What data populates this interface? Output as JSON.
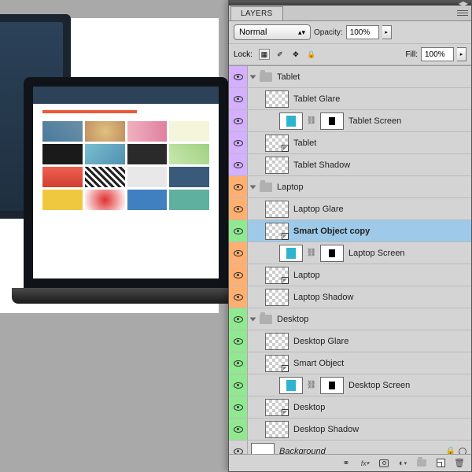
{
  "panel": {
    "title": "LAYERS",
    "blend_mode": "Normal",
    "opacity_label": "Opacity:",
    "opacity_value": "100%",
    "lock_label": "Lock:",
    "fill_label": "Fill:",
    "fill_value": "100%"
  },
  "groups": [
    {
      "name": "Tablet",
      "color": "purple",
      "expanded": true,
      "layers": [
        {
          "name": "Tablet Glare",
          "type": "transparent"
        },
        {
          "name": "Tablet Screen",
          "type": "fill-cyan",
          "hasMask": true,
          "linked": true
        },
        {
          "name": "Tablet",
          "type": "transparent",
          "hasCorner": true
        },
        {
          "name": "Tablet Shadow",
          "type": "transparent"
        }
      ]
    },
    {
      "name": "Laptop",
      "color": "orange",
      "expanded": true,
      "layers": [
        {
          "name": "Laptop Glare",
          "type": "transparent"
        },
        {
          "name": "Smart Object copy",
          "type": "smart",
          "selected": true,
          "color": "green",
          "bold": true
        },
        {
          "name": "Laptop Screen",
          "type": "fill-cyan",
          "hasMask": true,
          "linked": true
        },
        {
          "name": "Laptop",
          "type": "transparent",
          "hasCorner": true
        },
        {
          "name": "Laptop Shadow",
          "type": "transparent"
        }
      ]
    },
    {
      "name": "Desktop",
      "color": "green",
      "expanded": true,
      "layers": [
        {
          "name": "Desktop Glare",
          "type": "transparent"
        },
        {
          "name": "Smart Object",
          "type": "smart"
        },
        {
          "name": "Desktop Screen",
          "type": "fill-cyan",
          "hasMask": true,
          "linked": true
        },
        {
          "name": "Desktop",
          "type": "transparent",
          "hasCorner": true
        },
        {
          "name": "Desktop Shadow",
          "type": "transparent"
        }
      ]
    }
  ],
  "background_layer": "Background",
  "bottom_icons": [
    "link",
    "fx",
    "mask",
    "adjustment",
    "group",
    "new",
    "trash"
  ]
}
